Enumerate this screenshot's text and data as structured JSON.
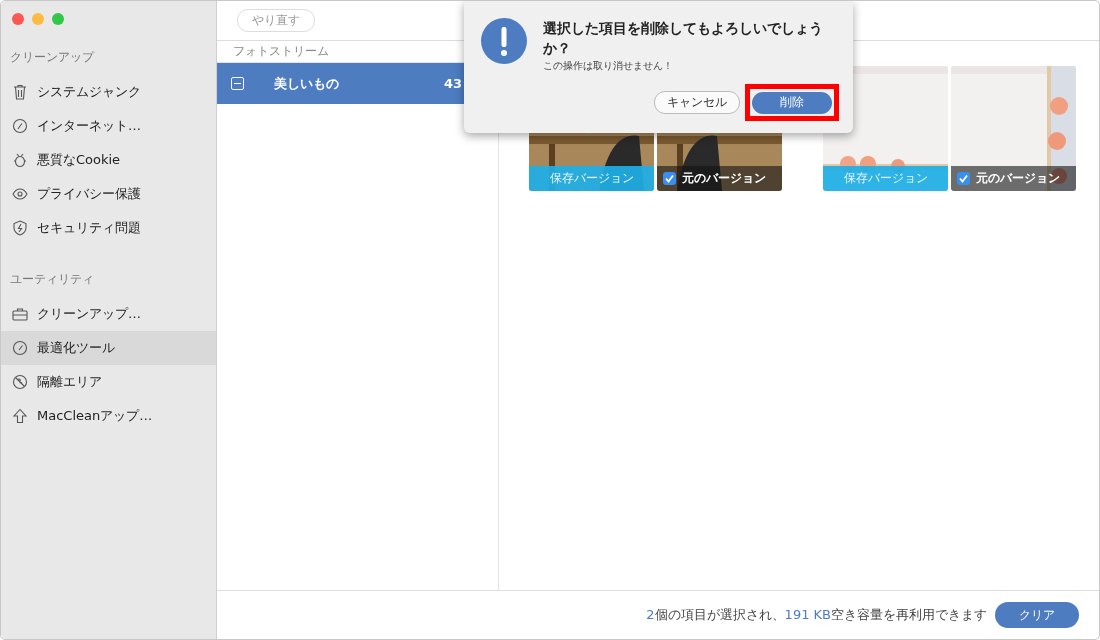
{
  "sidebar": {
    "sections": [
      {
        "heading": "クリーンアップ",
        "items": [
          {
            "label": "システムジャンク",
            "selected": false
          },
          {
            "label": "インターネット…",
            "selected": false
          },
          {
            "label": "悪質なCookie",
            "selected": false
          },
          {
            "label": "プライバシー保護",
            "selected": false
          },
          {
            "label": "セキュリティ問題",
            "selected": false
          }
        ]
      },
      {
        "heading": "ユーティリティ",
        "items": [
          {
            "label": "クリーンアップ…",
            "selected": false
          },
          {
            "label": "最適化ツール",
            "selected": true
          },
          {
            "label": "隔離エリア",
            "selected": false
          },
          {
            "label": "MacCleanアップ…",
            "selected": false
          }
        ]
      }
    ]
  },
  "toolbar": {
    "redo_button": "やり直す"
  },
  "album_list": {
    "heading": "フォトストリーム",
    "rows": [
      {
        "name": "美しいもの",
        "count": "43",
        "selected": true,
        "mixed": true
      }
    ]
  },
  "photo_pairs": [
    {
      "tiles": [
        {
          "kind": "saved",
          "label": "保存バージョン"
        },
        {
          "kind": "original",
          "label": "元のバージョン",
          "checked": true
        }
      ]
    },
    {
      "tiles": [
        {
          "kind": "saved",
          "label": "保存バージョン"
        },
        {
          "kind": "original",
          "label": "元のバージョン",
          "checked": true
        }
      ]
    }
  ],
  "dialog": {
    "title": "選択した項目を削除してもよろしいでしょうか？",
    "message": "この操作は取り消せません！",
    "cancel_button": "キャンセル",
    "delete_button": {
      "label": "削除",
      "highlighted": true
    }
  },
  "status_bar": {
    "summary": [
      {
        "text": "2",
        "emphasis": true
      },
      {
        "text": "個の項目が選択され、",
        "emphasis": false
      },
      {
        "text": "191 KB",
        "emphasis": true
      },
      {
        "text": "空き容量を再利用できます",
        "emphasis": false
      }
    ],
    "clear_button": "クリア"
  }
}
